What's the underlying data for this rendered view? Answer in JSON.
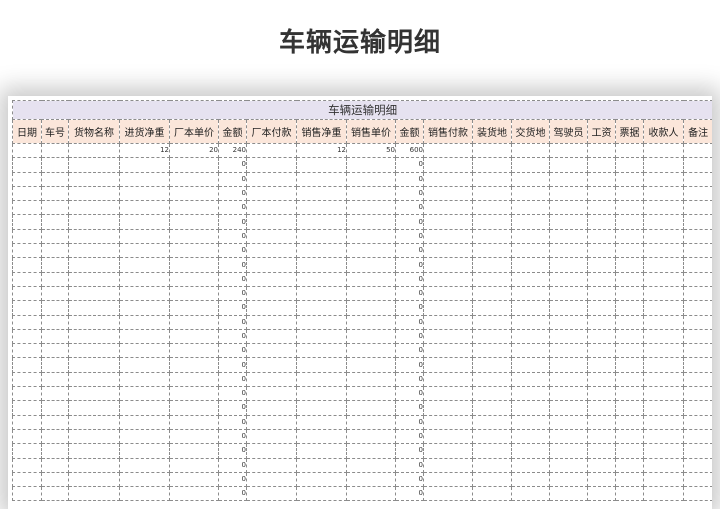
{
  "page_title": "车辆运输明细",
  "sheet_title": "车辆运输明细",
  "columns": [
    "日期",
    "车号",
    "货物名称",
    "进货净重",
    "厂本单价",
    "金额",
    "厂本付款",
    "销售净重",
    "销售单价",
    "金额",
    "销售付款",
    "装货地",
    "交货地",
    "驾驶员",
    "工资",
    "票据",
    "收款人",
    "备注"
  ],
  "rows": [
    [
      "",
      "",
      "",
      "12",
      "20",
      "240",
      "",
      "12",
      "50",
      "600",
      "",
      "",
      "",
      "",
      "",
      "",
      "",
      ""
    ],
    [
      "",
      "",
      "",
      "",
      "",
      "0",
      "",
      "",
      "",
      "0",
      "",
      "",
      "",
      "",
      "",
      "",
      "",
      ""
    ],
    [
      "",
      "",
      "",
      "",
      "",
      "0",
      "",
      "",
      "",
      "0",
      "",
      "",
      "",
      "",
      "",
      "",
      "",
      ""
    ],
    [
      "",
      "",
      "",
      "",
      "",
      "0",
      "",
      "",
      "",
      "0",
      "",
      "",
      "",
      "",
      "",
      "",
      "",
      ""
    ],
    [
      "",
      "",
      "",
      "",
      "",
      "0",
      "",
      "",
      "",
      "0",
      "",
      "",
      "",
      "",
      "",
      "",
      "",
      ""
    ],
    [
      "",
      "",
      "",
      "",
      "",
      "0",
      "",
      "",
      "",
      "0",
      "",
      "",
      "",
      "",
      "",
      "",
      "",
      ""
    ],
    [
      "",
      "",
      "",
      "",
      "",
      "0",
      "",
      "",
      "",
      "0",
      "",
      "",
      "",
      "",
      "",
      "",
      "",
      ""
    ],
    [
      "",
      "",
      "",
      "",
      "",
      "0",
      "",
      "",
      "",
      "0",
      "",
      "",
      "",
      "",
      "",
      "",
      "",
      ""
    ],
    [
      "",
      "",
      "",
      "",
      "",
      "0",
      "",
      "",
      "",
      "0",
      "",
      "",
      "",
      "",
      "",
      "",
      "",
      ""
    ],
    [
      "",
      "",
      "",
      "",
      "",
      "0",
      "",
      "",
      "",
      "0",
      "",
      "",
      "",
      "",
      "",
      "",
      "",
      ""
    ],
    [
      "",
      "",
      "",
      "",
      "",
      "0",
      "",
      "",
      "",
      "0",
      "",
      "",
      "",
      "",
      "",
      "",
      "",
      ""
    ],
    [
      "",
      "",
      "",
      "",
      "",
      "0",
      "",
      "",
      "",
      "0",
      "",
      "",
      "",
      "",
      "",
      "",
      "",
      ""
    ],
    [
      "",
      "",
      "",
      "",
      "",
      "0",
      "",
      "",
      "",
      "0",
      "",
      "",
      "",
      "",
      "",
      "",
      "",
      ""
    ],
    [
      "",
      "",
      "",
      "",
      "",
      "0",
      "",
      "",
      "",
      "0",
      "",
      "",
      "",
      "",
      "",
      "",
      "",
      ""
    ],
    [
      "",
      "",
      "",
      "",
      "",
      "0",
      "",
      "",
      "",
      "0",
      "",
      "",
      "",
      "",
      "",
      "",
      "",
      ""
    ],
    [
      "",
      "",
      "",
      "",
      "",
      "0",
      "",
      "",
      "",
      "0",
      "",
      "",
      "",
      "",
      "",
      "",
      "",
      ""
    ],
    [
      "",
      "",
      "",
      "",
      "",
      "0",
      "",
      "",
      "",
      "0",
      "",
      "",
      "",
      "",
      "",
      "",
      "",
      ""
    ],
    [
      "",
      "",
      "",
      "",
      "",
      "0",
      "",
      "",
      "",
      "0",
      "",
      "",
      "",
      "",
      "",
      "",
      "",
      ""
    ],
    [
      "",
      "",
      "",
      "",
      "",
      "0",
      "",
      "",
      "",
      "0",
      "",
      "",
      "",
      "",
      "",
      "",
      "",
      ""
    ],
    [
      "",
      "",
      "",
      "",
      "",
      "0",
      "",
      "",
      "",
      "0",
      "",
      "",
      "",
      "",
      "",
      "",
      "",
      ""
    ],
    [
      "",
      "",
      "",
      "",
      "",
      "0",
      "",
      "",
      "",
      "0",
      "",
      "",
      "",
      "",
      "",
      "",
      "",
      ""
    ],
    [
      "",
      "",
      "",
      "",
      "",
      "0",
      "",
      "",
      "",
      "0",
      "",
      "",
      "",
      "",
      "",
      "",
      "",
      ""
    ],
    [
      "",
      "",
      "",
      "",
      "",
      "0",
      "",
      "",
      "",
      "0",
      "",
      "",
      "",
      "",
      "",
      "",
      "",
      ""
    ],
    [
      "",
      "",
      "",
      "",
      "",
      "0",
      "",
      "",
      "",
      "0",
      "",
      "",
      "",
      "",
      "",
      "",
      "",
      ""
    ],
    [
      "",
      "",
      "",
      "",
      "",
      "0",
      "",
      "",
      "",
      "0",
      "",
      "",
      "",
      "",
      "",
      "",
      "",
      ""
    ]
  ],
  "colors": {
    "title_bar": "#e6e2f0",
    "header_fill": "#fbe6da",
    "grid_line": "#8c8c8c"
  }
}
